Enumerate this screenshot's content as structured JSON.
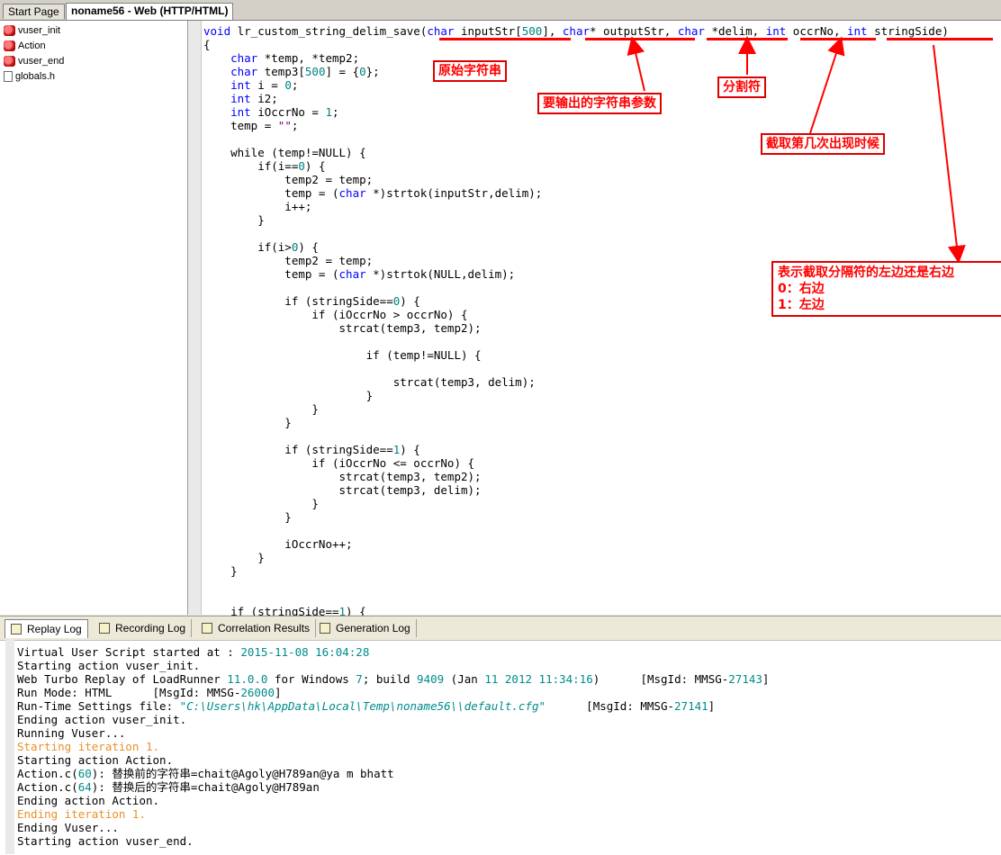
{
  "tabs": [
    {
      "label": "Start Page"
    },
    {
      "label": "noname56 - Web (HTTP/HTML)"
    }
  ],
  "tree": {
    "items": [
      {
        "label": "vuser_init",
        "icon": "red-block-icon"
      },
      {
        "label": "Action",
        "icon": "red-block-icon"
      },
      {
        "label": "vuser_end",
        "icon": "red-block-icon"
      },
      {
        "label": "globals.h",
        "icon": "file-icon"
      }
    ]
  },
  "code": {
    "lines": [
      "void lr_custom_string_delim_save(char inputStr[500], char* outputStr, char *delim, int occrNo, int stringSide)",
      "{",
      "    char *temp, *temp2;",
      "    char temp3[500] = {0};",
      "    int i = 0;",
      "    int i2;",
      "    int iOccrNo = 1;",
      "    temp = \"\";",
      "",
      "    while (temp!=NULL) {",
      "        if(i==0) {",
      "            temp2 = temp;",
      "            temp = (char *)strtok(inputStr,delim);",
      "            i++;",
      "        }",
      "",
      "        if(i>0) {",
      "            temp2 = temp;",
      "            temp = (char *)strtok(NULL,delim);",
      "",
      "            if (stringSide==0) {",
      "                if (iOccrNo > occrNo) {",
      "                    strcat(temp3, temp2);",
      "",
      "                        if (temp!=NULL) {",
      "",
      "                            strcat(temp3, delim);",
      "                        }",
      "                }",
      "            }",
      "",
      "            if (stringSide==1) {",
      "                if (iOccrNo <= occrNo) {",
      "                    strcat(temp3, temp2);",
      "                    strcat(temp3, delim);",
      "                }",
      "            }",
      "",
      "            iOccrNo++;",
      "        }",
      "    }",
      "",
      "",
      "    if (stringSide==1) {"
    ]
  },
  "annotations": {
    "input": "原始字符串",
    "output": "要输出的字符串参数",
    "delim": "分割符",
    "occr": "截取第几次出现时候",
    "side_title": "表示截取分隔符的左边还是右边",
    "side_0": "0：右边",
    "side_1": "1：左边"
  },
  "log_tabs": [
    {
      "label": "Replay Log"
    },
    {
      "label": "Recording Log"
    },
    {
      "label": "Correlation Results"
    },
    {
      "label": "Generation Log"
    }
  ],
  "log": {
    "lines": [
      "Virtual User Script started at : 2015-11-08 16:04:28",
      "Starting action vuser_init.",
      "Web Turbo Replay of LoadRunner 11.0.0 for Windows 7; build 9409 (Jan 11 2012 11:34:16)      [MsgId: MMSG-27143]",
      "Run Mode: HTML      [MsgId: MMSG-26000]",
      "Run-Time Settings file: \"C:\\Users\\hk\\AppData\\Local\\Temp\\noname56\\\\default.cfg\"      [MsgId: MMSG-27141]",
      "Ending action vuser_init.",
      "Running Vuser...",
      "Starting iteration 1.",
      "Starting action Action.",
      "Action.c(60): 替换前的字符串=chait@Agoly@H789an@ya m bhatt",
      "Action.c(64): 替换后的字符串=chait@Agoly@H789an",
      "Ending action Action.",
      "Ending iteration 1.",
      "Ending Vuser...",
      "Starting action vuser_end."
    ]
  },
  "colors": {
    "keyword": "#0000ff",
    "number": "#008080",
    "annotation": "#ff0000",
    "iteration": "#e8902a"
  }
}
